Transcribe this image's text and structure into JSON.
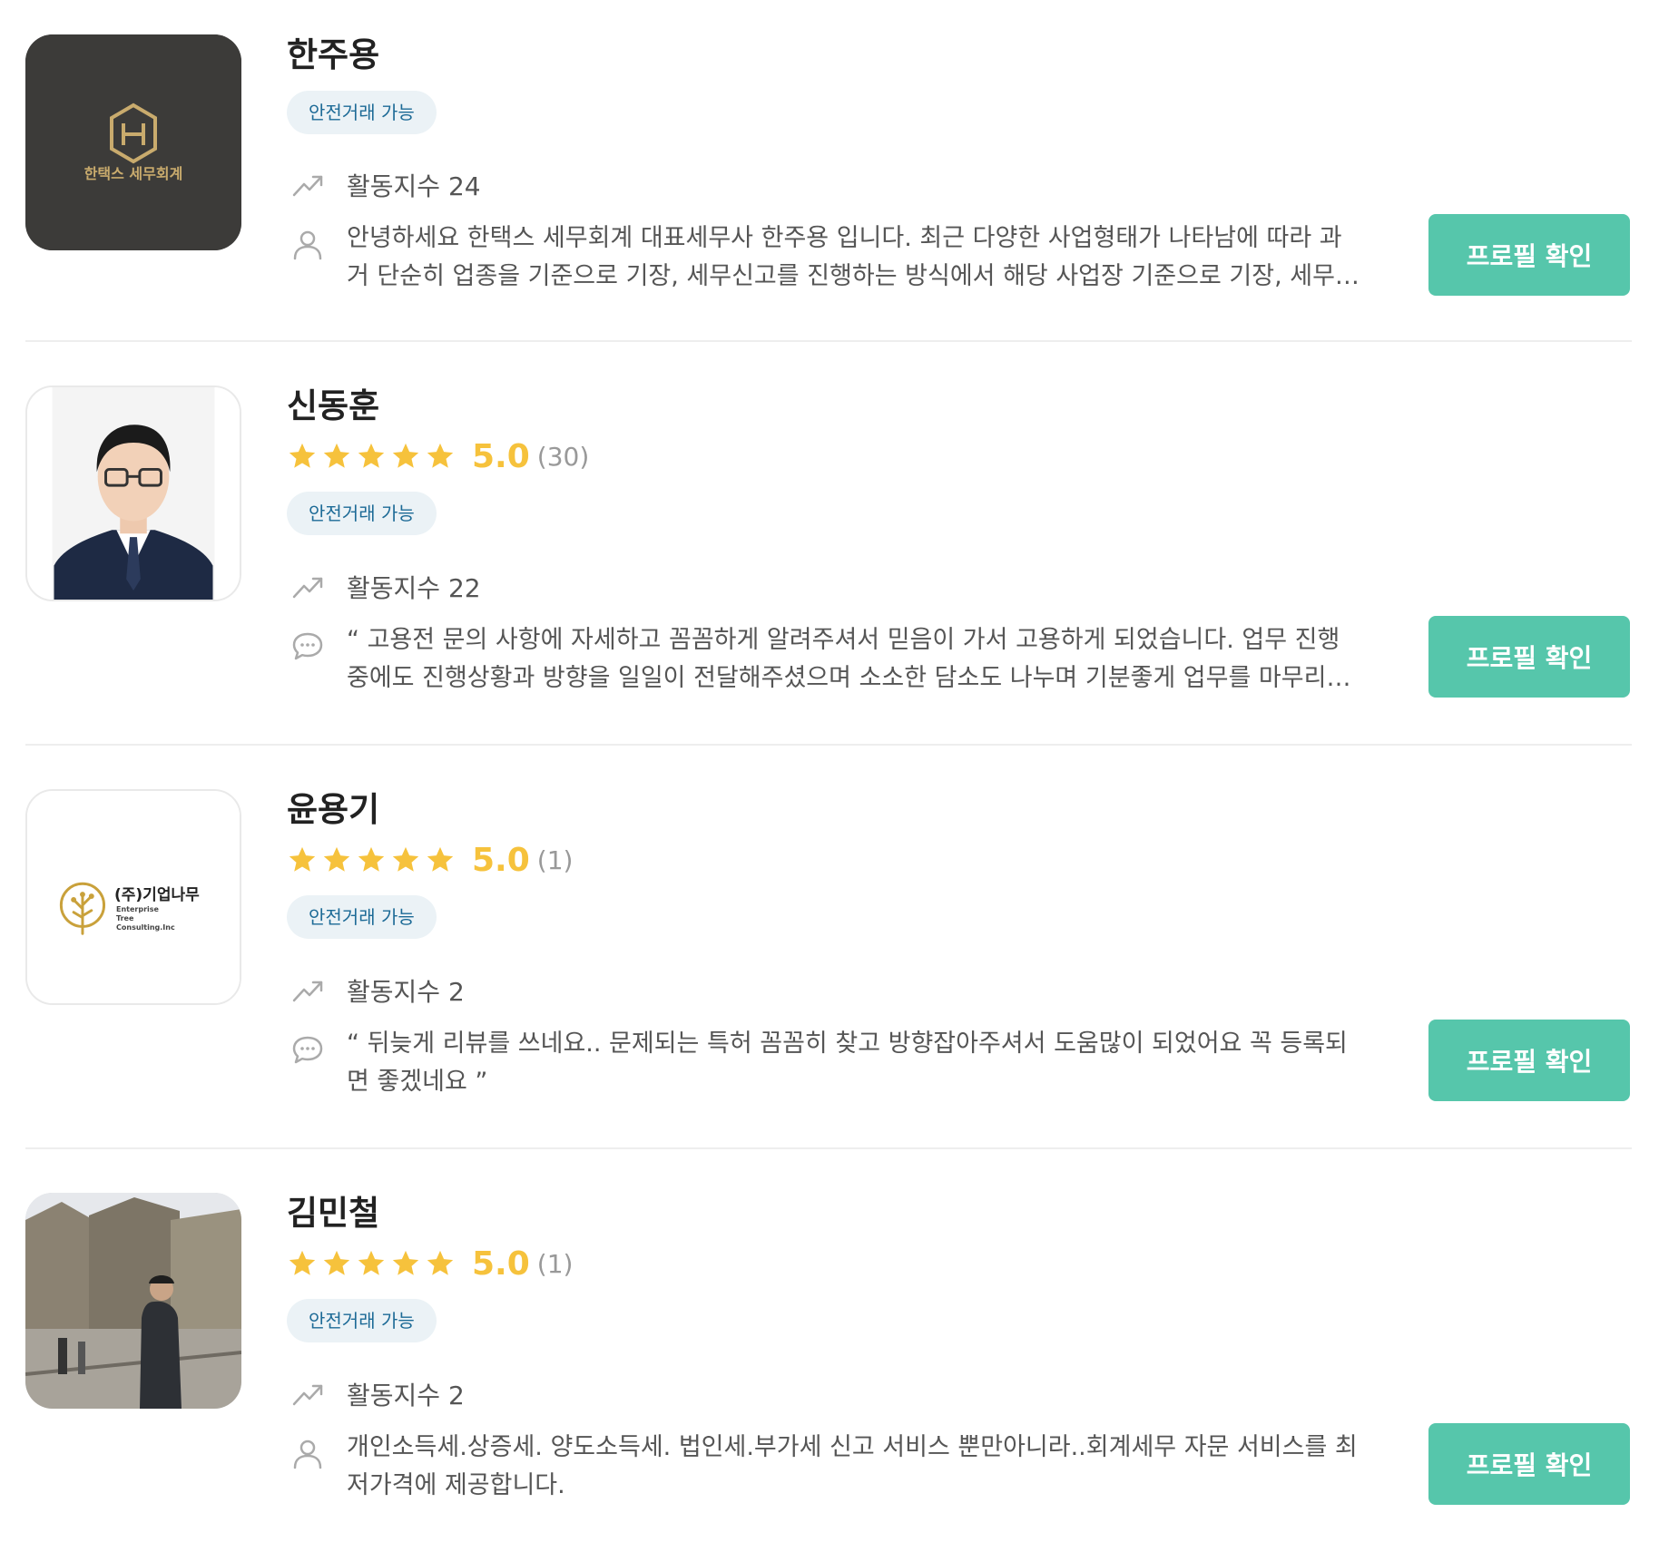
{
  "experts": [
    {
      "name": "한주용",
      "avatar_logo_text": "한택스 세무회계",
      "badge": "안전거래 가능",
      "activity": "활동지수 24",
      "description": "안녕하세요 한택스 세무회계 대표세무사 한주용 입니다. 최근 다양한 사업형태가 나타남에 따라 과거 단순히 업종을 기준으로 기장, 세무신고를 진행하는 방식에서 해당 사업장 기준으로 기장, 세무신고를 진행하는 방식으로 변화하고 있습니다.",
      "description_icon": "user-icon",
      "button": "프로필 확인"
    },
    {
      "name": "신동훈",
      "rating_score": "5.0",
      "rating_count": "(30)",
      "rating_stars": 5,
      "badge": "안전거래 가능",
      "activity": "활동지수 22",
      "description": "“ 고용전 문의 사항에 자세하고 꼼꼼하게 알려주셔서 믿음이 가서 고용하게 되었습니다. 업무 진행 중에도 진행상황과 방향을 일일이 전달해주셨으며 소소한 담소도 나누며 기분좋게 업무를 마무리할 수 있었습니다. ”",
      "description_icon": "chat-bubble-icon",
      "button": "프로필 확인"
    },
    {
      "name": "윤용기",
      "avatar_logo_text": "(주)기업나무",
      "avatar_logo_sub": [
        "Enterprise",
        "Tree",
        "Consulting.Inc"
      ],
      "rating_score": "5.0",
      "rating_count": "(1)",
      "rating_stars": 5,
      "badge": "안전거래 가능",
      "activity": "활동지수 2",
      "description": "“ 뒤늦게 리뷰를 쓰네요.. 문제되는 특허 꼼꼼히 찾고 방향잡아주셔서 도움많이 되었어요 꼭 등록되면 좋겠네요 ”",
      "description_icon": "chat-bubble-icon",
      "button": "프로필 확인"
    },
    {
      "name": "김민철",
      "rating_score": "5.0",
      "rating_count": "(1)",
      "rating_stars": 5,
      "badge": "안전거래 가능",
      "activity": "활동지수 2",
      "description": "개인소득세.상증세. 양도소득세. 법인세.부가세 신고 서비스 뿐만아니라..회계세무 자문 서비스를 최저가격에 제공합니다.",
      "description_icon": "user-icon",
      "button": "프로필 확인"
    }
  ],
  "colors": {
    "button": "#56c6ab",
    "star": "#f6c23c",
    "badge_bg": "#ebf2f6",
    "badge_text": "#1c6a96"
  }
}
